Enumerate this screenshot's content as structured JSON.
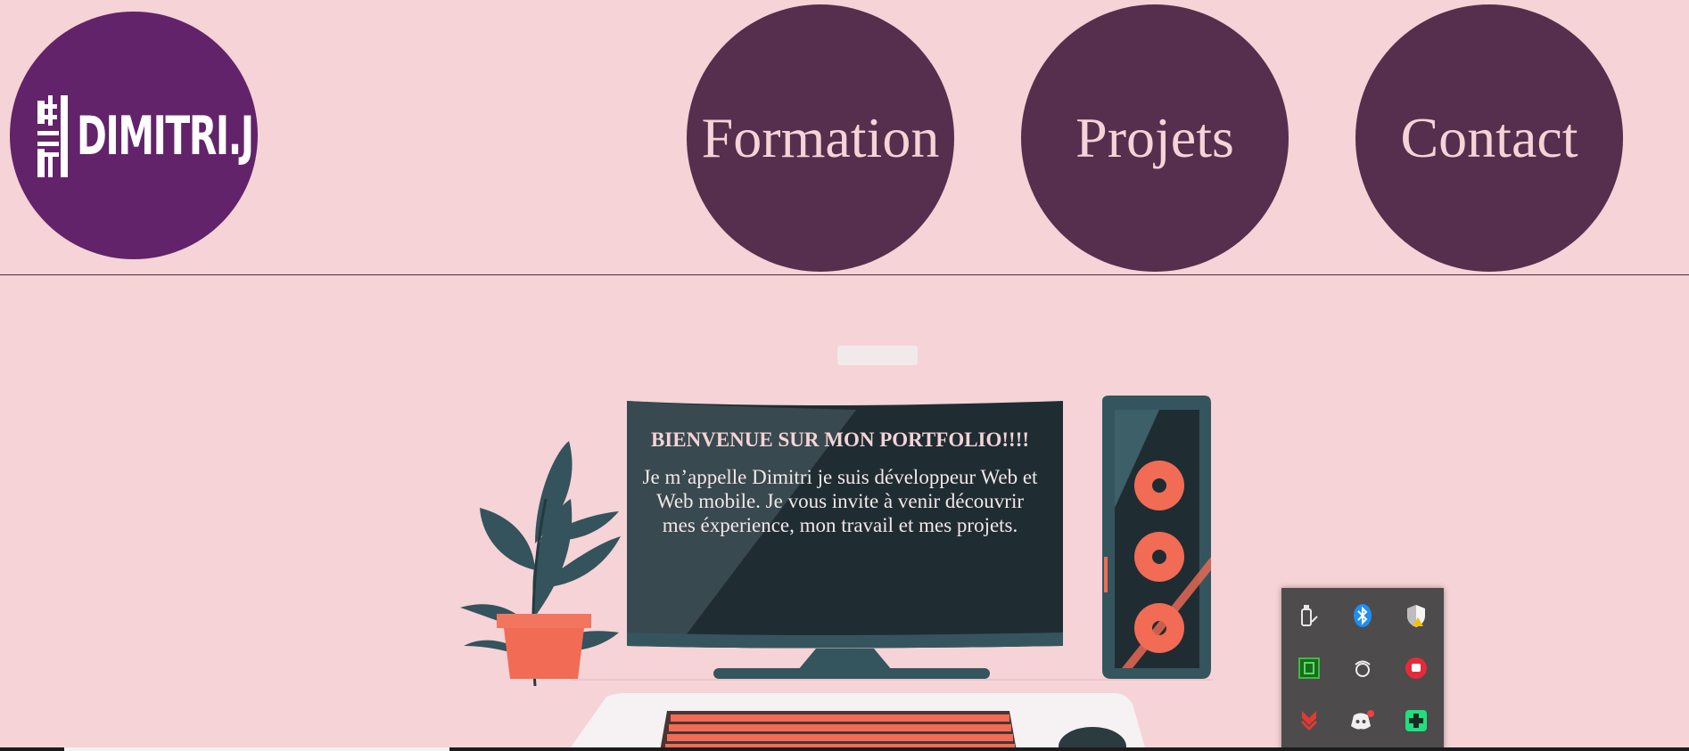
{
  "header": {
    "logo_text": "DIMITRI.J",
    "nav": [
      {
        "label": "Formation"
      },
      {
        "label": "Projets"
      },
      {
        "label": "Contact"
      }
    ]
  },
  "hero": {
    "title": "BIENVENUE SUR MON PORTFOLIO!!!!",
    "text": "Je m’appelle Dimitri je suis développeur Web et Web mobile. Je vous invite à venir découvrir mes éxperience, mon travail et mes projets."
  },
  "tray": {
    "icons": [
      "usb-drive-icon",
      "bluetooth-icon",
      "security-shield-icon",
      "green-app-icon",
      "steelseries-icon",
      "red-fist-app-icon",
      "download-arrow-icon",
      "discord-icon",
      "green-gamepad-app-icon"
    ]
  },
  "colors": {
    "background": "#f5d3d6",
    "logo_circle": "#62236a",
    "nav_circle": "#562e4e",
    "nav_text": "#f5d3d6",
    "screen_dark": "#1f2d33",
    "accent_orange": "#f26b55",
    "tray_bg": "#4d4b4c"
  }
}
